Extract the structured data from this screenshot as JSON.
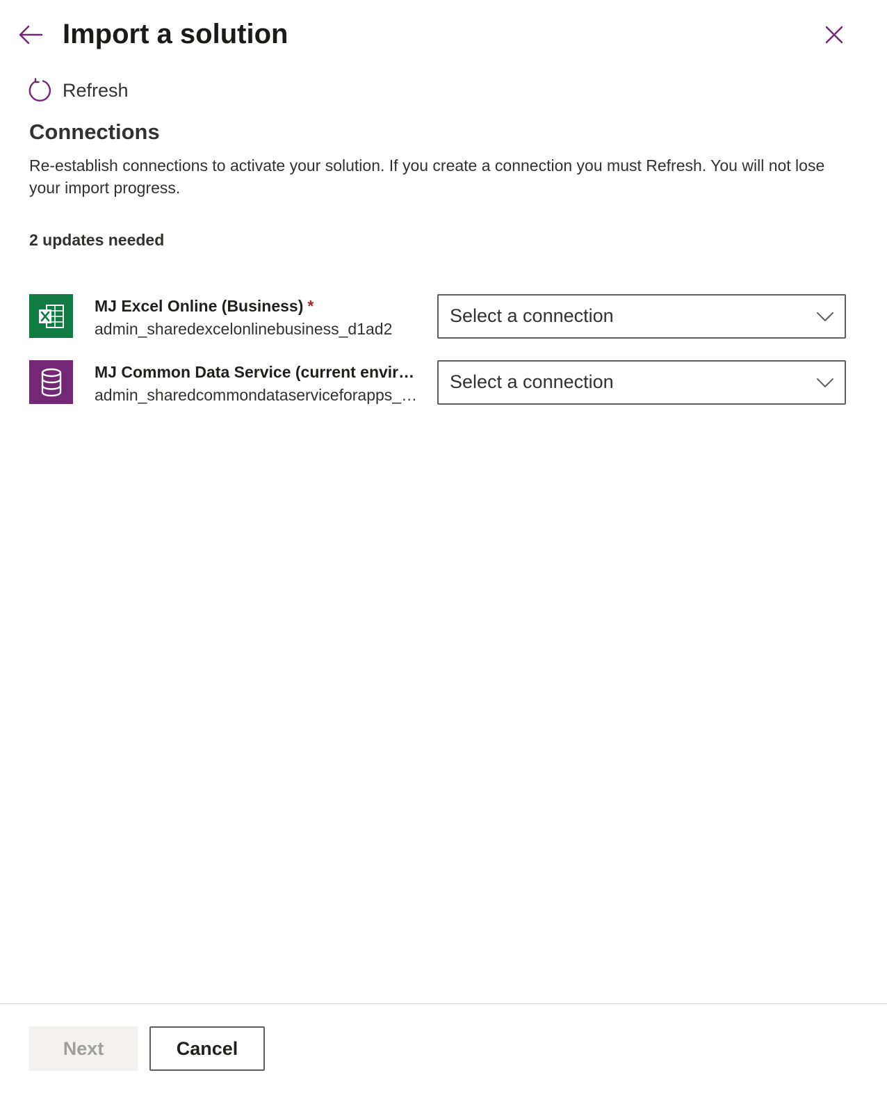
{
  "header": {
    "title": "Import a solution",
    "back_icon": "arrow-left-icon",
    "close_icon": "close-icon",
    "accent_color": "#742774"
  },
  "toolbar": {
    "refresh_label": "Refresh",
    "refresh_icon": "refresh-icon"
  },
  "section": {
    "title": "Connections",
    "description": "Re-establish connections to activate your solution. If you create a connection you must Refresh. You will not lose your import progress.",
    "updates_needed": "2 updates needed"
  },
  "connections": [
    {
      "name": "MJ Excel Online (Business)",
      "required_marker": "*",
      "id": "admin_sharedexcelonlinebusiness_d1ad2",
      "icon": "excel-icon",
      "icon_color": "#107c41",
      "select_label": "Select a connection"
    },
    {
      "name": "MJ Common Data Service (current environment)",
      "id": "admin_sharedcommondataserviceforapps_xxxxx",
      "icon": "database-icon",
      "icon_color": "#742774",
      "select_label": "Select a connection"
    }
  ],
  "footer": {
    "next_label": "Next",
    "cancel_label": "Cancel",
    "next_disabled": true
  }
}
